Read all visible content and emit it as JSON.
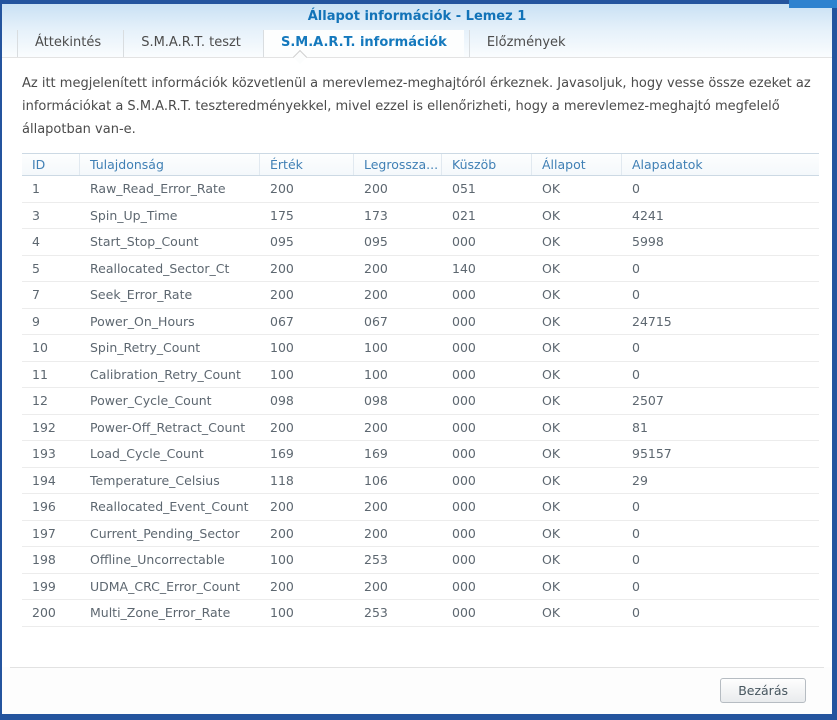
{
  "window": {
    "title": "Állapot információk - Lemez 1"
  },
  "tabs": [
    {
      "label": "Áttekintés",
      "active": false
    },
    {
      "label": "S.M.A.R.T. teszt",
      "active": false
    },
    {
      "label": "S.M.A.R.T. információk",
      "active": true
    },
    {
      "label": "Előzmények",
      "active": false
    }
  ],
  "description": "Az itt megjelenített információk közvetlenül a merevlemez-meghajtóról érkeznek. Javasoljuk, hogy vesse össze ezeket az információkat a S.M.A.R.T. teszteredményekkel, mivel ezzel is ellenőrizheti, hogy a merevlemez-meghajtó megfelelő állapotban van-e.",
  "table": {
    "columns": [
      "ID",
      "Tulajdonság",
      "Érték",
      "Legrossza...",
      "Küszöb",
      "Állapot",
      "Alapadatok"
    ],
    "rows": [
      [
        "1",
        "Raw_Read_Error_Rate",
        "200",
        "200",
        "051",
        "OK",
        "0"
      ],
      [
        "3",
        "Spin_Up_Time",
        "175",
        "173",
        "021",
        "OK",
        "4241"
      ],
      [
        "4",
        "Start_Stop_Count",
        "095",
        "095",
        "000",
        "OK",
        "5998"
      ],
      [
        "5",
        "Reallocated_Sector_Ct",
        "200",
        "200",
        "140",
        "OK",
        "0"
      ],
      [
        "7",
        "Seek_Error_Rate",
        "200",
        "200",
        "000",
        "OK",
        "0"
      ],
      [
        "9",
        "Power_On_Hours",
        "067",
        "067",
        "000",
        "OK",
        "24715"
      ],
      [
        "10",
        "Spin_Retry_Count",
        "100",
        "100",
        "000",
        "OK",
        "0"
      ],
      [
        "11",
        "Calibration_Retry_Count",
        "100",
        "100",
        "000",
        "OK",
        "0"
      ],
      [
        "12",
        "Power_Cycle_Count",
        "098",
        "098",
        "000",
        "OK",
        "2507"
      ],
      [
        "192",
        "Power-Off_Retract_Count",
        "200",
        "200",
        "000",
        "OK",
        "81"
      ],
      [
        "193",
        "Load_Cycle_Count",
        "169",
        "169",
        "000",
        "OK",
        "95157"
      ],
      [
        "194",
        "Temperature_Celsius",
        "118",
        "106",
        "000",
        "OK",
        "29"
      ],
      [
        "196",
        "Reallocated_Event_Count",
        "200",
        "200",
        "000",
        "OK",
        "0"
      ],
      [
        "197",
        "Current_Pending_Sector",
        "200",
        "200",
        "000",
        "OK",
        "0"
      ],
      [
        "198",
        "Offline_Uncorrectable",
        "100",
        "253",
        "000",
        "OK",
        "0"
      ],
      [
        "199",
        "UDMA_CRC_Error_Count",
        "200",
        "200",
        "000",
        "OK",
        "0"
      ],
      [
        "200",
        "Multi_Zone_Error_Rate",
        "100",
        "253",
        "000",
        "OK",
        "0"
      ]
    ]
  },
  "footer": {
    "close_label": "Bezárás"
  },
  "colors": {
    "window_border": "#24549e",
    "corner_accent": "#2e82cf",
    "title_text": "#1273b8",
    "active_tab_text": "#1579bd",
    "header_text": "#4080b5",
    "cell_text": "#5d6770"
  }
}
